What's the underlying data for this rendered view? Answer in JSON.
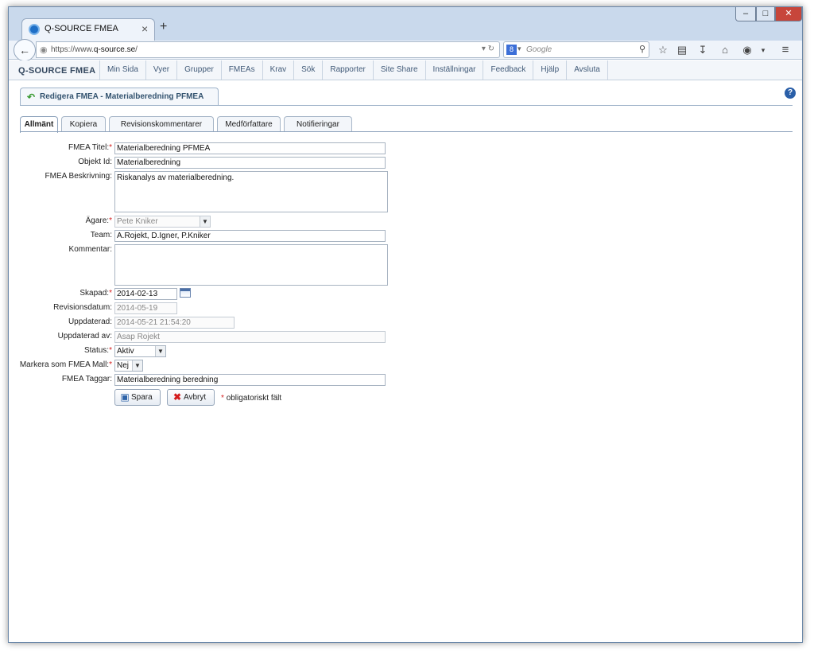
{
  "browser": {
    "tab_title": "Q-SOURCE FMEA",
    "tab_close": "×",
    "new_tab": "+",
    "url_prefix": "https://www.",
    "url_domain": "q-source.se",
    "url_suffix": "/",
    "search_placeholder": "Google"
  },
  "app": {
    "brand": "Q-SOURCE FMEA",
    "menu": [
      "Min Sida",
      "Vyer",
      "Grupper",
      "FMEAs",
      "Krav",
      "Sök",
      "Rapporter",
      "Site Share",
      "Inställningar",
      "Feedback",
      "Hjälp",
      "Avsluta"
    ]
  },
  "page": {
    "title": "Redigera FMEA - Materialberedning PFMEA",
    "help": "?",
    "tabs": [
      "Allmänt",
      "Kopiera",
      "Revisionskommentarer",
      "Medförfattare",
      "Notifieringar"
    ]
  },
  "form": {
    "labels": {
      "titel": "FMEA Titel:",
      "objekt": "Objekt Id:",
      "beskrivning": "FMEA Beskrivning:",
      "agare": "Ägare:",
      "team": "Team:",
      "kommentar": "Kommentar:",
      "skapad": "Skapad:",
      "revisionsdatum": "Revisionsdatum:",
      "uppdaterad": "Uppdaterad:",
      "uppdaterad_av": "Uppdaterad av:",
      "status": "Status:",
      "mall": "Markera som FMEA Mall:",
      "taggar": "FMEA Taggar:"
    },
    "required_mark": "*",
    "values": {
      "titel": "Materialberedning PFMEA",
      "objekt": "Materialberedning",
      "beskrivning": "Riskanalys av materialberedning.",
      "agare": "Pete Kniker",
      "team": "A.Rojekt, D.Igner, P.Kniker",
      "kommentar": "",
      "skapad": "2014-02-13",
      "revisionsdatum": "2014-05-19",
      "uppdaterad": "2014-05-21 21:54:20",
      "uppdaterad_av": "Asap Rojekt",
      "status": "Aktiv",
      "mall": "Nej",
      "taggar": "Materialberedning beredning"
    },
    "buttons": {
      "save": "Spara",
      "cancel": "Avbryt"
    },
    "required_note": "obligatoriskt fält"
  },
  "colors": {
    "accent": "#415a78",
    "required": "#d41c1c",
    "help": "#2a5fa8"
  }
}
